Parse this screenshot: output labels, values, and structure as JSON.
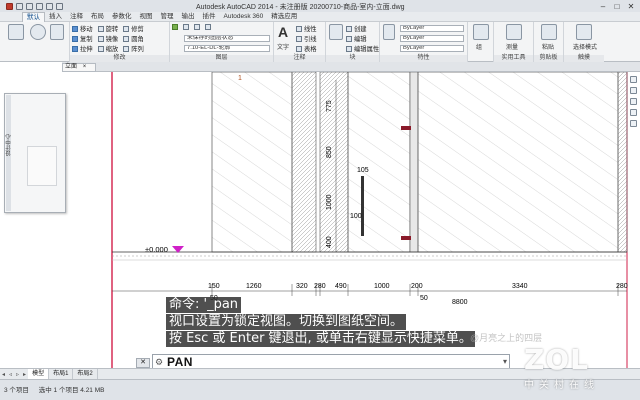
{
  "window": {
    "title": "Autodesk AutoCAD 2014 - 未注册版    20200710-商品-室内-立面.dwg"
  },
  "ribbon_tabs": [
    "默认",
    "插入",
    "注释",
    "布局",
    "参数化",
    "视图",
    "管理",
    "输出",
    "插件",
    "Autodesk 360",
    "精选应用"
  ],
  "ribbon": {
    "draw_row1": [
      "移动",
      "旋转",
      "修剪"
    ],
    "draw_row2": [
      "复制",
      "镜像",
      "圆角"
    ],
    "draw_row3": [
      "拉伸",
      "缩放",
      "阵列"
    ],
    "modify_title": "修改",
    "layer_state": "未保存的图层状态",
    "layer_name": "7.10-EL-DL-轮廓",
    "layer_title": "图层",
    "text_label": "文字",
    "annotate_row1": "线性",
    "annotate_row2": "引线",
    "annotate_row3": "表格",
    "annotate_title": "注释",
    "block_row1": "创建",
    "block_row2": "编辑",
    "block_row3": "编辑属性",
    "block_title": "块",
    "bylayer1": "ByLayer",
    "bylayer2": "ByLayer",
    "bylayer3": "ByLayer",
    "properties_title": "特性",
    "group_label": "组",
    "measure_label": "测量",
    "utilities_title": "实用工具",
    "paste_label": "粘贴",
    "clipboard_title": "剪贴板",
    "select_label": "选择模式",
    "touch_title": "触摸"
  },
  "file_tab": "立面",
  "palette_title": "设计中心",
  "drawing": {
    "elevation_label": "±0.000",
    "dims_vertical": [
      "775",
      "850",
      "1000",
      "400",
      "105",
      "100"
    ],
    "dims_bottom": [
      "150",
      "1260",
      "320",
      "280",
      "490",
      "1000",
      "200",
      "3340",
      "280"
    ],
    "dims_bottom2": [
      "50",
      "50",
      "8800"
    ],
    "top_tick": "1"
  },
  "command": {
    "history": [
      "命令: '_pan",
      "视口设置为锁定视图。切换到图纸空间。",
      "按 Esc 或 Enter 键退出, 或单击右键显示快捷菜单。"
    ],
    "input_value": "PAN"
  },
  "layout_tabs": [
    "模型",
    "布局1",
    "布局2"
  ],
  "status": {
    "item_count": "3 个项目",
    "selected": "选中 1 个项目  4.21 MB"
  },
  "watermark": {
    "brand": "ZOL",
    "sub": "中关村在线",
    "faint": "@月亮之上的四层"
  }
}
